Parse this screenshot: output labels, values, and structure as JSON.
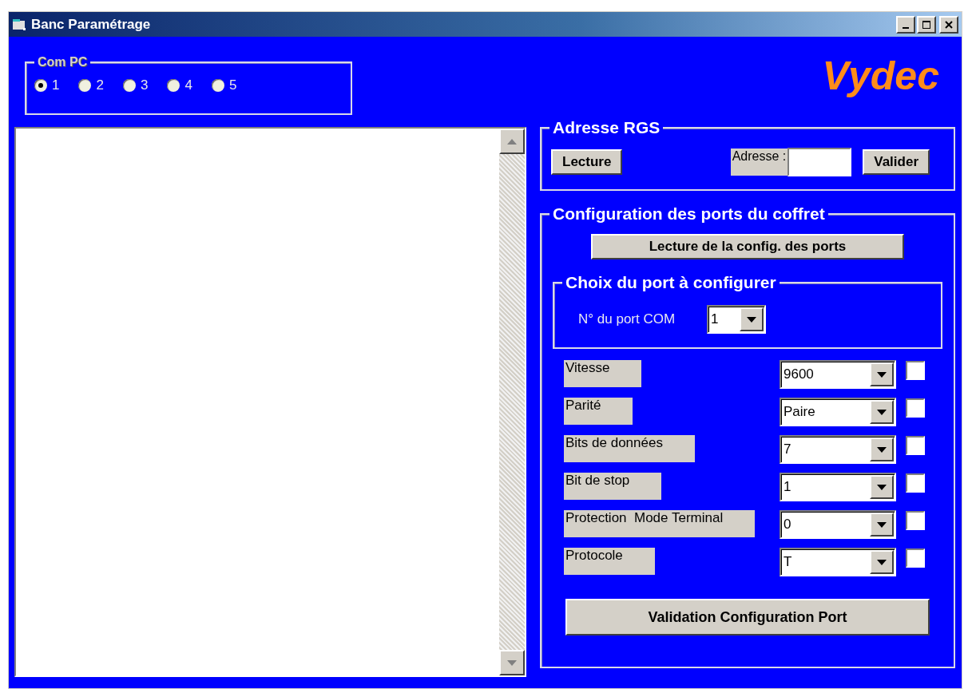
{
  "window": {
    "title": "Banc Paramétrage"
  },
  "com_pc": {
    "label": "Com PC",
    "options": [
      {
        "label": "1",
        "selected": true
      },
      {
        "label": "2",
        "selected": false
      },
      {
        "label": "3",
        "selected": false
      },
      {
        "label": "4",
        "selected": false
      },
      {
        "label": "5",
        "selected": false
      }
    ]
  },
  "logo": "Vydec",
  "adresse_rgs": {
    "title": "Adresse RGS",
    "read_button": "Lecture",
    "address_label": "Adresse :",
    "validate_button": "Valider"
  },
  "config": {
    "title": "Configuration des ports du coffret",
    "read_button": "Lecture de la config. des ports",
    "port_choice": {
      "title": "Choix du port à configurer",
      "label": "N° du port COM",
      "value": "1"
    },
    "settings": [
      {
        "label": "Vitesse",
        "value": "9600",
        "checked": false
      },
      {
        "label": "Parité",
        "value": "Paire",
        "checked": false
      },
      {
        "label": "Bits de données",
        "value": "7",
        "checked": false
      },
      {
        "label": "Bit de stop",
        "value": "1",
        "checked": false
      },
      {
        "label": "Protection  Mode Terminal",
        "value": "0",
        "checked": false
      },
      {
        "label": "Protocole",
        "value": "T",
        "checked": false
      }
    ],
    "validate_button": "Validation Configuration Port"
  }
}
